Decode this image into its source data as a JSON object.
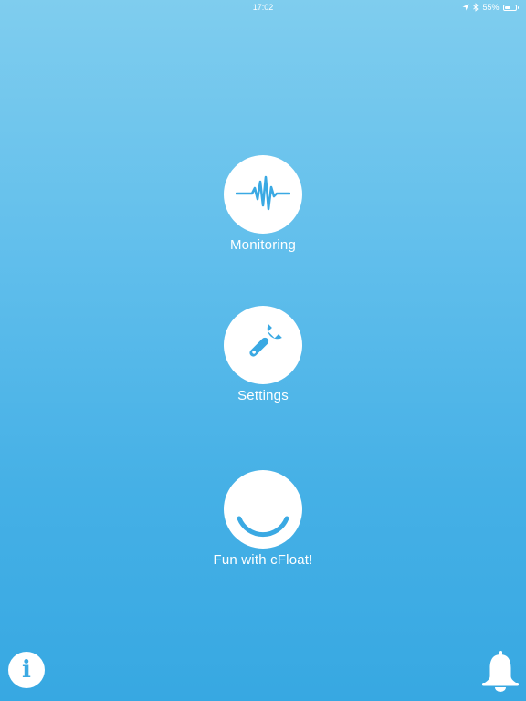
{
  "status_bar": {
    "time": "17:02",
    "battery_percent": "55%",
    "battery_level": 0.55,
    "icons": [
      "location-arrow-icon",
      "bluetooth-icon",
      "battery-icon"
    ]
  },
  "menu": {
    "items": [
      {
        "label": "Monitoring",
        "icon": "heartbeat-icon"
      },
      {
        "label": "Settings",
        "icon": "wrench-icon"
      },
      {
        "label": "Fun with cFloat!",
        "icon": "smile-icon"
      }
    ]
  },
  "bottom": {
    "info_icon": "info-icon",
    "bell_icon": "bell-icon"
  },
  "colors": {
    "accent": "#3aa9e3",
    "background_top": "#7fcdee",
    "background_bottom": "#37a8e2",
    "foreground": "#ffffff"
  }
}
